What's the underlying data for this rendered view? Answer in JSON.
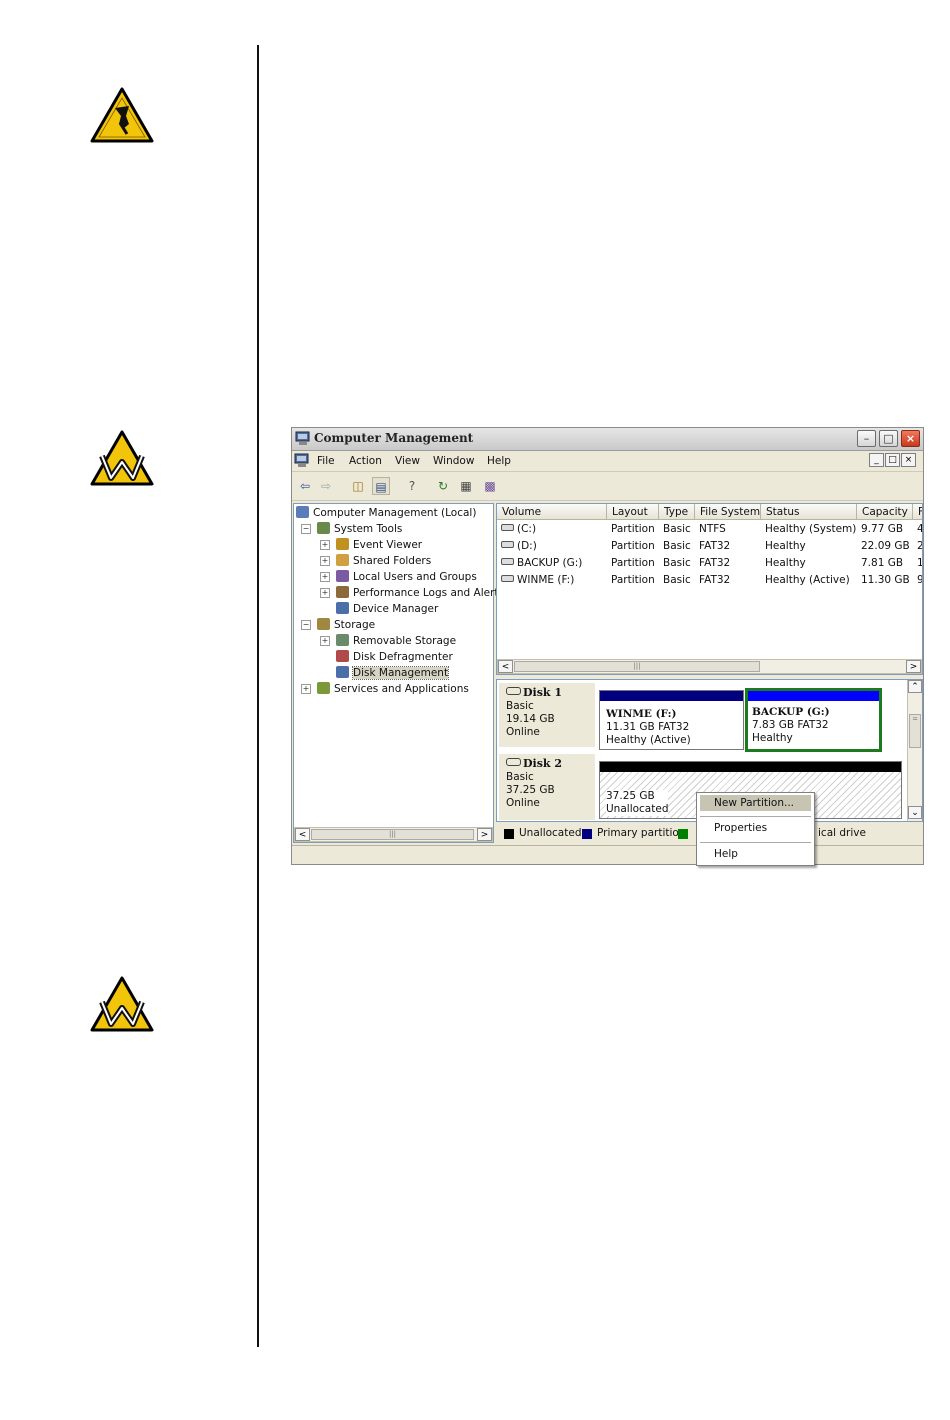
{
  "window": {
    "title": "Computer Management",
    "menu": [
      "File",
      "Action",
      "View",
      "Window",
      "Help"
    ],
    "mdi_buttons": [
      "_",
      "□",
      "×"
    ]
  },
  "tree": {
    "items": [
      {
        "label": "Computer Management (Local)",
        "level": 0,
        "expander": ""
      },
      {
        "label": "System Tools",
        "level": 1,
        "expander": "−"
      },
      {
        "label": "Event Viewer",
        "level": 2,
        "expander": "+"
      },
      {
        "label": "Shared Folders",
        "level": 2,
        "expander": "+"
      },
      {
        "label": "Local Users and Groups",
        "level": 2,
        "expander": "+"
      },
      {
        "label": "Performance Logs and Alerts",
        "level": 2,
        "expander": "+"
      },
      {
        "label": "Device Manager",
        "level": 2,
        "expander": ""
      },
      {
        "label": "Storage",
        "level": 1,
        "expander": "−"
      },
      {
        "label": "Removable Storage",
        "level": 2,
        "expander": "+"
      },
      {
        "label": "Disk Defragmenter",
        "level": 2,
        "expander": ""
      },
      {
        "label": "Disk Management",
        "level": 2,
        "expander": "",
        "selected": true
      },
      {
        "label": "Services and Applications",
        "level": 1,
        "expander": "+"
      }
    ]
  },
  "volumes": {
    "columns": [
      "Volume",
      "Layout",
      "Type",
      "File System",
      "Status",
      "Capacity",
      "F"
    ],
    "rows": [
      [
        "(C:)",
        "Partition",
        "Basic",
        "NTFS",
        "Healthy (System)",
        "9.77 GB",
        "4"
      ],
      [
        "(D:)",
        "Partition",
        "Basic",
        "FAT32",
        "Healthy",
        "22.09 GB",
        "2"
      ],
      [
        "BACKUP (G:)",
        "Partition",
        "Basic",
        "FAT32",
        "Healthy",
        "7.81 GB",
        "1"
      ],
      [
        "WINME (F:)",
        "Partition",
        "Basic",
        "FAT32",
        "Healthy (Active)",
        "11.30 GB",
        "9"
      ]
    ]
  },
  "disks": [
    {
      "name": "Disk 1",
      "type": "Basic",
      "size": "19.14 GB",
      "state": "Online",
      "partitions": [
        {
          "name": "WINME  (F:)",
          "detail": "11.31 GB FAT32",
          "status": "Healthy (Active)"
        },
        {
          "name": "BACKUP  (G:)",
          "detail": "7.83 GB FAT32",
          "status": "Healthy"
        }
      ]
    },
    {
      "name": "Disk 2",
      "type": "Basic",
      "size": "37.25 GB",
      "state": "Online",
      "partitions": [
        {
          "name": "",
          "detail": "37.25 GB",
          "status": "Unallocated"
        }
      ]
    }
  ],
  "legend": {
    "unallocated": "Unallocated",
    "primary": "Primary partition",
    "logical_fragment": "ical drive"
  },
  "context_menu": {
    "items": [
      "New Partition...",
      "Properties",
      "Help"
    ]
  },
  "colors": {
    "primary_partition": "#000080",
    "selected_partition": "#0000ff",
    "unallocated": "#000000",
    "extended": "#008000",
    "warning_icon": "#f2c40a"
  },
  "icons": [
    "caution-icon",
    "warning-icon",
    "warning-icon"
  ]
}
